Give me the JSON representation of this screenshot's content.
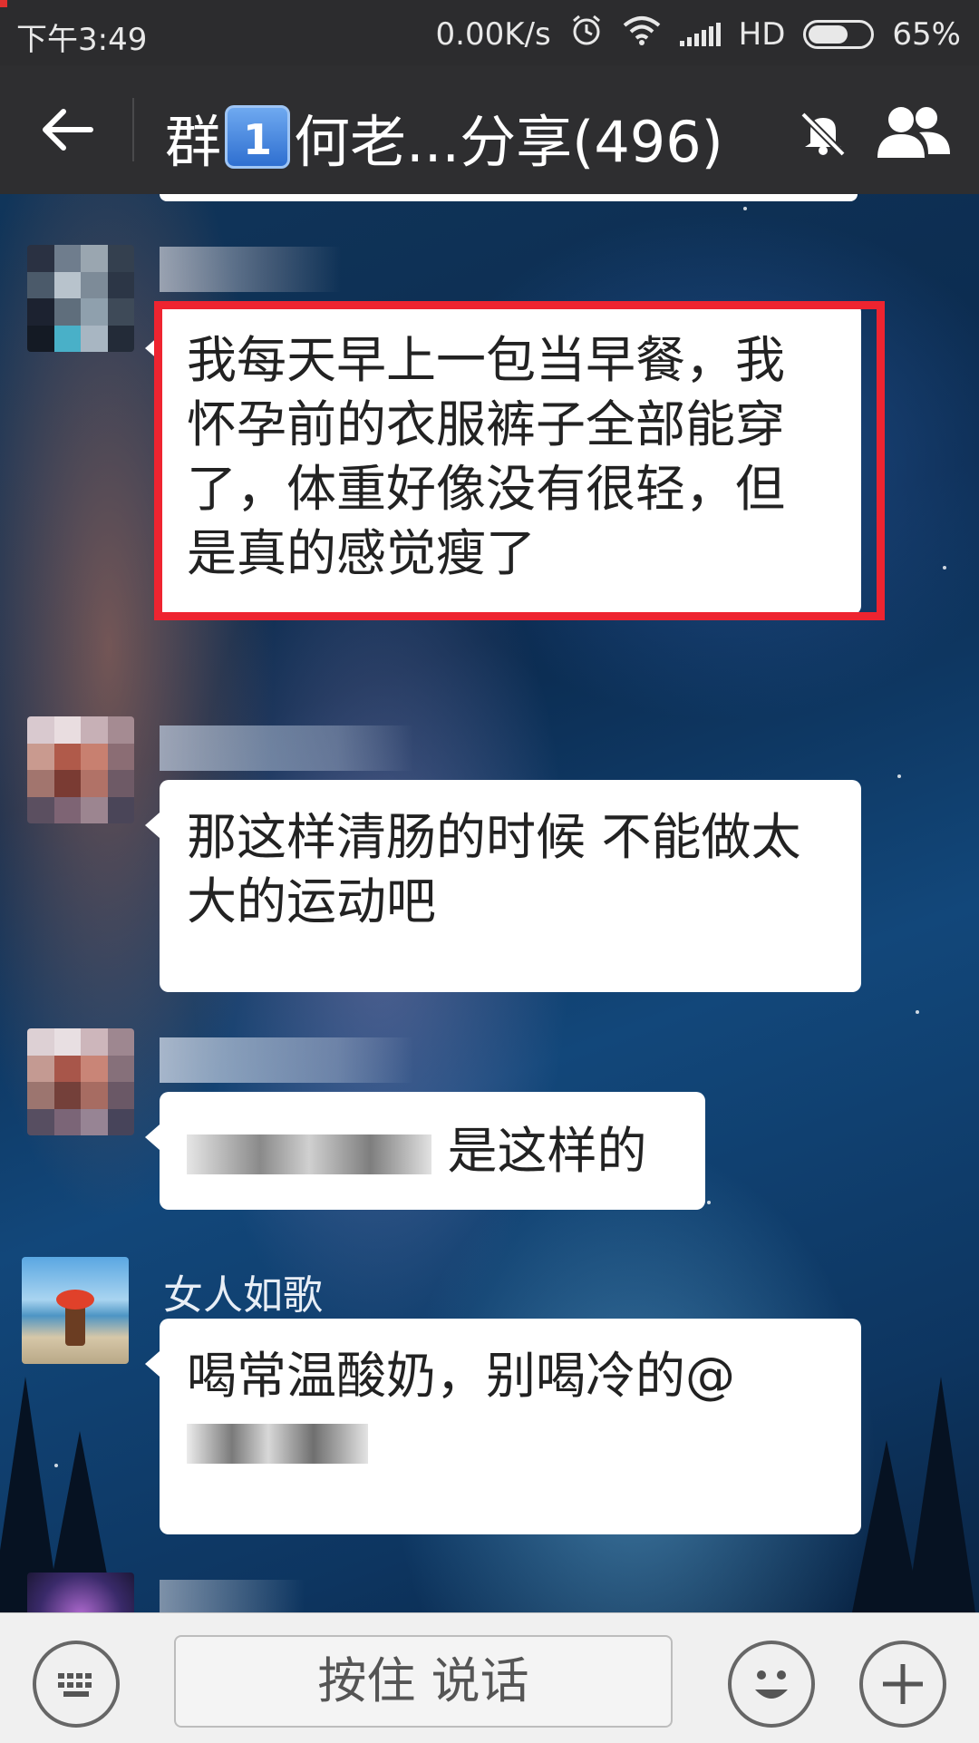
{
  "status_bar": {
    "time": "下午3:49",
    "network_speed": "0.00K/s",
    "network_label": "HD",
    "battery": "65%",
    "battery_level": 0.65,
    "icons": [
      "alarm-icon",
      "wifi-icon",
      "signal-icon",
      "battery-icon"
    ]
  },
  "header": {
    "title_prefix": "群",
    "title_badge": "1",
    "title_suffix": "何老...分享(496)",
    "icons": [
      "back-arrow-icon",
      "mute-bell-icon",
      "group-members-icon"
    ]
  },
  "messages": [
    {
      "sender": "",
      "text": "我每天早上一包当早餐，我怀孕前的衣服裤子全部能穿了，体重好像没有很轻，但是真的感觉瘦了",
      "highlighted": true
    },
    {
      "sender": "",
      "text": "那这样清肠的时候 不能做太大的运动吧"
    },
    {
      "sender": "",
      "text": "是这样的"
    },
    {
      "sender": "女人如歌",
      "text": "喝常温酸奶，别喝冷的@"
    }
  ],
  "input_bar": {
    "hold_to_talk": "按住 说话",
    "icons": [
      "keyboard-icon",
      "emoji-icon",
      "plus-icon"
    ]
  },
  "colors": {
    "highlight_border": "#ee2430",
    "bar_background": "#2e2e30",
    "bubble": "#ffffff"
  }
}
